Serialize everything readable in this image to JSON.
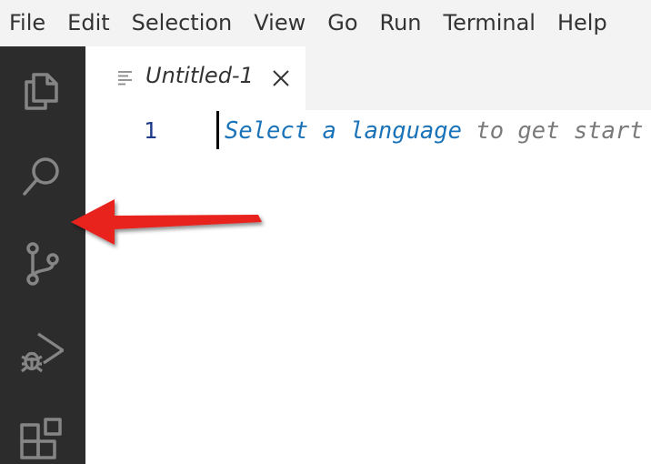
{
  "menubar": {
    "items": [
      "File",
      "Edit",
      "Selection",
      "View",
      "Go",
      "Run",
      "Terminal",
      "Help"
    ]
  },
  "activitybar": {
    "icons": [
      "explorer-icon",
      "search-icon",
      "source-control-icon",
      "run-debug-icon",
      "extensions-icon"
    ]
  },
  "tab": {
    "label": "Untitled-1",
    "icon": "file-lines-icon",
    "close_icon": "close-icon"
  },
  "editor": {
    "line_number": "1",
    "hint_link": "Select a language",
    "hint_rest": " to get start"
  },
  "colors": {
    "menubar_bg": "#f3f3f3",
    "activitybar_bg": "#2c2c2c",
    "annotation_arrow": "#e8201c",
    "hint_link": "#1a73b8"
  }
}
